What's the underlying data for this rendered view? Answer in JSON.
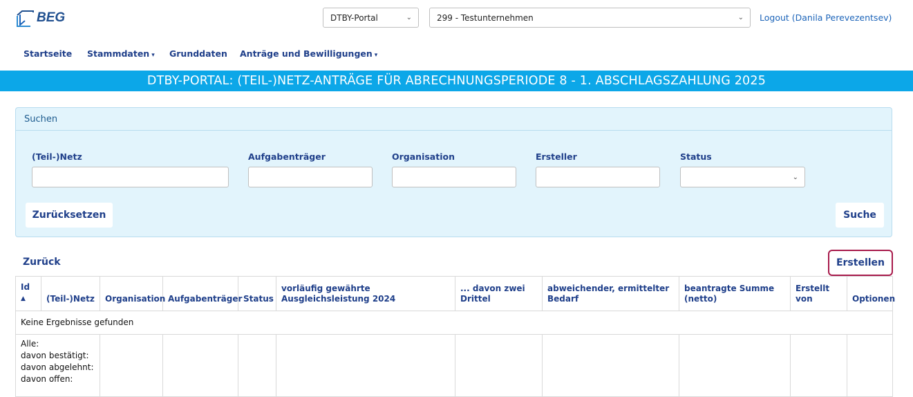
{
  "app": {
    "logo_text": "BEG",
    "portal_select": "DTBY-Portal",
    "company_select": "299 - Testunternehmen",
    "logout": "Logout (Danila Perevezentsev)"
  },
  "nav": {
    "startseite": "Startseite",
    "stammdaten": "Stammdaten",
    "grunddaten": "Grunddaten",
    "antraege": "Anträge und Bewilligungen"
  },
  "banner": "DTBY-PORTAL: (TEIL-)NETZ-ANTRÄGE FÜR ABRECHNUNGSPERIODE 8 - 1. ABSCHLAGSZAHLUNG 2025",
  "search": {
    "header": "Suchen",
    "fields": {
      "netz": "(Teil-)Netz",
      "aufgabentraeger": "Aufgabenträger",
      "organisation": "Organisation",
      "ersteller": "Ersteller",
      "status": "Status"
    },
    "reset": "Zurücksetzen",
    "submit": "Suche"
  },
  "actions": {
    "back": "Zurück",
    "create": "Erstellen"
  },
  "table": {
    "headers": [
      "Id",
      "(Teil-)Netz",
      "Organisation",
      "Aufgabenträger",
      "Status",
      "vorläufig gewährte Ausgleichsleistung 2024",
      "... davon zwei Drittel",
      "abweichender, ermittelter Bedarf",
      "beantragte Summe (netto)",
      "Erstellt von",
      "Optionen"
    ],
    "empty": "Keine Ergebnisse gefunden",
    "summary": [
      "Alle:",
      "davon bestätigt:",
      "davon abgelehnt:",
      "davon offen:"
    ]
  },
  "colors": {
    "banner": "#0ca7e8",
    "link": "#1f3f8a",
    "panel": "#e2f4fc",
    "highlight": "#a7194a"
  },
  "icons": [
    "logo-icon",
    "chevron-down-icon",
    "caret-down-icon",
    "sort-asc-icon"
  ]
}
